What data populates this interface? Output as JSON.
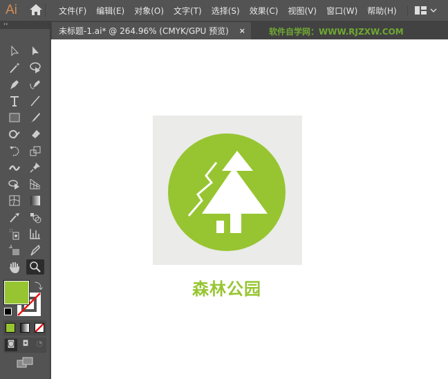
{
  "app": {
    "logo": "Ai"
  },
  "menu": [
    "文件(F)",
    "编辑(E)",
    "对象(O)",
    "文字(T)",
    "选择(S)",
    "效果(C)",
    "视图(V)",
    "窗口(W)",
    "帮助(H)"
  ],
  "tab": {
    "label": "未标题-1.ai* @ 264.96% (CMYK/GPU 预览)",
    "close": "×"
  },
  "watermark": "软件自学网：WWW.RJZXW.COM",
  "toolbar": {
    "collapse": "‹‹",
    "fill_color": "#97c532",
    "stroke": "none"
  },
  "artwork": {
    "title": "森林公园",
    "bg": "#ebebe9",
    "accent": "#97c532"
  }
}
